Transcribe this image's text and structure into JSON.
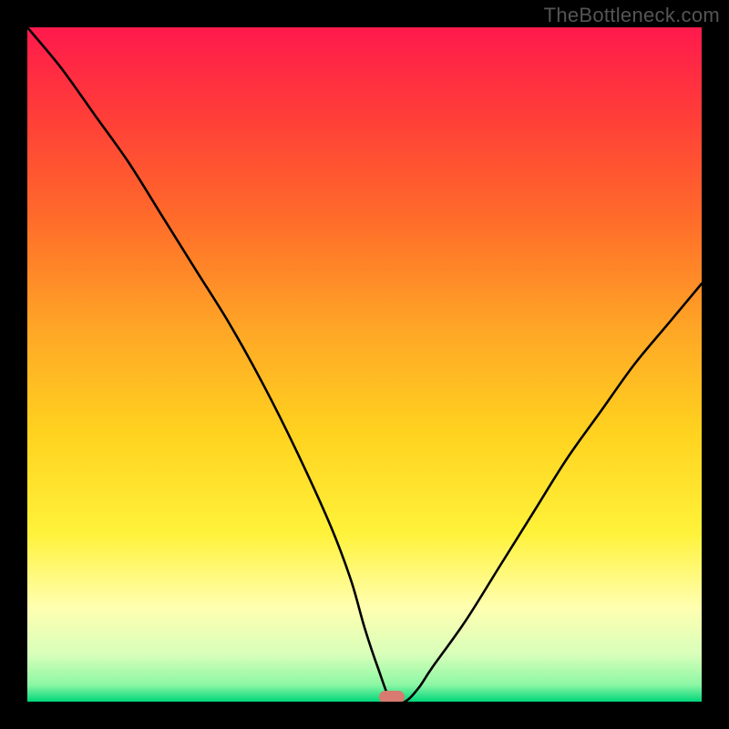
{
  "watermark": "TheBottleneck.com",
  "colors": {
    "frame": "#000000",
    "curve": "#000000",
    "marker": "#d87a6f",
    "gradient_stops": [
      {
        "offset": 0.0,
        "color": "#ff1a4d"
      },
      {
        "offset": 0.12,
        "color": "#ff3a3a"
      },
      {
        "offset": 0.28,
        "color": "#ff6a2a"
      },
      {
        "offset": 0.45,
        "color": "#ffa726"
      },
      {
        "offset": 0.6,
        "color": "#ffd21f"
      },
      {
        "offset": 0.75,
        "color": "#fff23a"
      },
      {
        "offset": 0.86,
        "color": "#ffffb0"
      },
      {
        "offset": 0.93,
        "color": "#d8ffba"
      },
      {
        "offset": 0.975,
        "color": "#8cf7a4"
      },
      {
        "offset": 1.0,
        "color": "#00d67a"
      }
    ]
  },
  "chart_data": {
    "type": "line",
    "title": "",
    "xlabel": "",
    "ylabel": "",
    "xlim": [
      0,
      100
    ],
    "ylim": [
      0,
      100
    ],
    "grid": false,
    "legend": false,
    "marker": {
      "x": 54,
      "y": 0
    },
    "series": [
      {
        "name": "bottleneck-curve",
        "x": [
          0,
          5,
          10,
          15,
          20,
          25,
          30,
          35,
          40,
          45,
          48,
          50,
          52,
          54,
          56,
          58,
          60,
          65,
          70,
          75,
          80,
          85,
          90,
          95,
          100
        ],
        "y": [
          100,
          94,
          87,
          80,
          72,
          64,
          56,
          47,
          37,
          26,
          18,
          11,
          5,
          0,
          0,
          2,
          5,
          12,
          20,
          28,
          36,
          43,
          50,
          56,
          62
        ]
      }
    ]
  }
}
